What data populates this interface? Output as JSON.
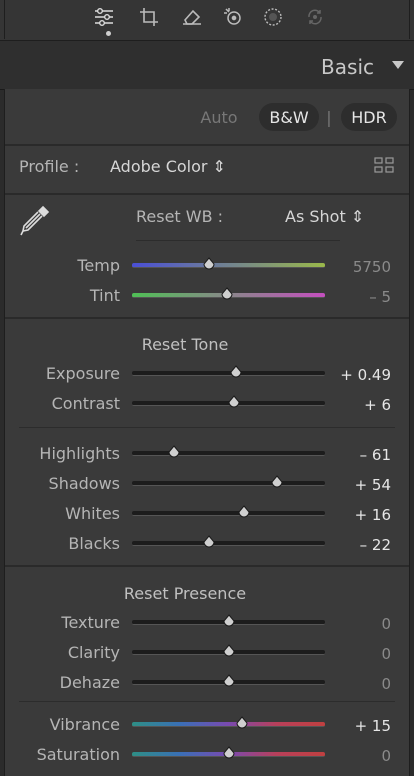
{
  "toolbar": {
    "icons": [
      "sliders-icon",
      "crop-icon",
      "eraser-icon",
      "healing-icon",
      "masking-icon",
      "redeye-icon"
    ]
  },
  "header": {
    "title": "Basic"
  },
  "treatment": {
    "auto": "Auto",
    "bw": "B&W",
    "divider": "|",
    "hdr": "HDR"
  },
  "profile": {
    "label": "Profile :",
    "value": "Adobe Color ⇕"
  },
  "wb": {
    "reset": "Reset WB :",
    "value": "As Shot ⇕"
  },
  "temp": {
    "label": "Temp",
    "value": "5750",
    "position": 0.4
  },
  "tint": {
    "label": "Tint",
    "value": "– 5",
    "position": 0.49
  },
  "tone": {
    "title": "Reset Tone"
  },
  "exposure": {
    "label": "Exposure",
    "value": "+ 0.49",
    "position": 0.54
  },
  "contrast": {
    "label": "Contrast",
    "value": "+ 6",
    "position": 0.53
  },
  "highlights": {
    "label": "Highlights",
    "value": "– 61",
    "position": 0.22
  },
  "shadows": {
    "label": "Shadows",
    "value": "+ 54",
    "position": 0.75
  },
  "whites": {
    "label": "Whites",
    "value": "+ 16",
    "position": 0.58
  },
  "blacks": {
    "label": "Blacks",
    "value": "– 22",
    "position": 0.4
  },
  "presence": {
    "title": "Reset Presence"
  },
  "texture": {
    "label": "Texture",
    "value": "0",
    "position": 0.5
  },
  "clarity": {
    "label": "Clarity",
    "value": "0",
    "position": 0.5
  },
  "dehaze": {
    "label": "Dehaze",
    "value": "0",
    "position": 0.5
  },
  "vibrance": {
    "label": "Vibrance",
    "value": "+ 15",
    "position": 0.57
  },
  "saturation": {
    "label": "Saturation",
    "value": "0",
    "position": 0.5
  },
  "colors": {
    "accent": "#cfcfcf",
    "panel": "#3a3a3a",
    "dim": "#8a8a8a"
  }
}
